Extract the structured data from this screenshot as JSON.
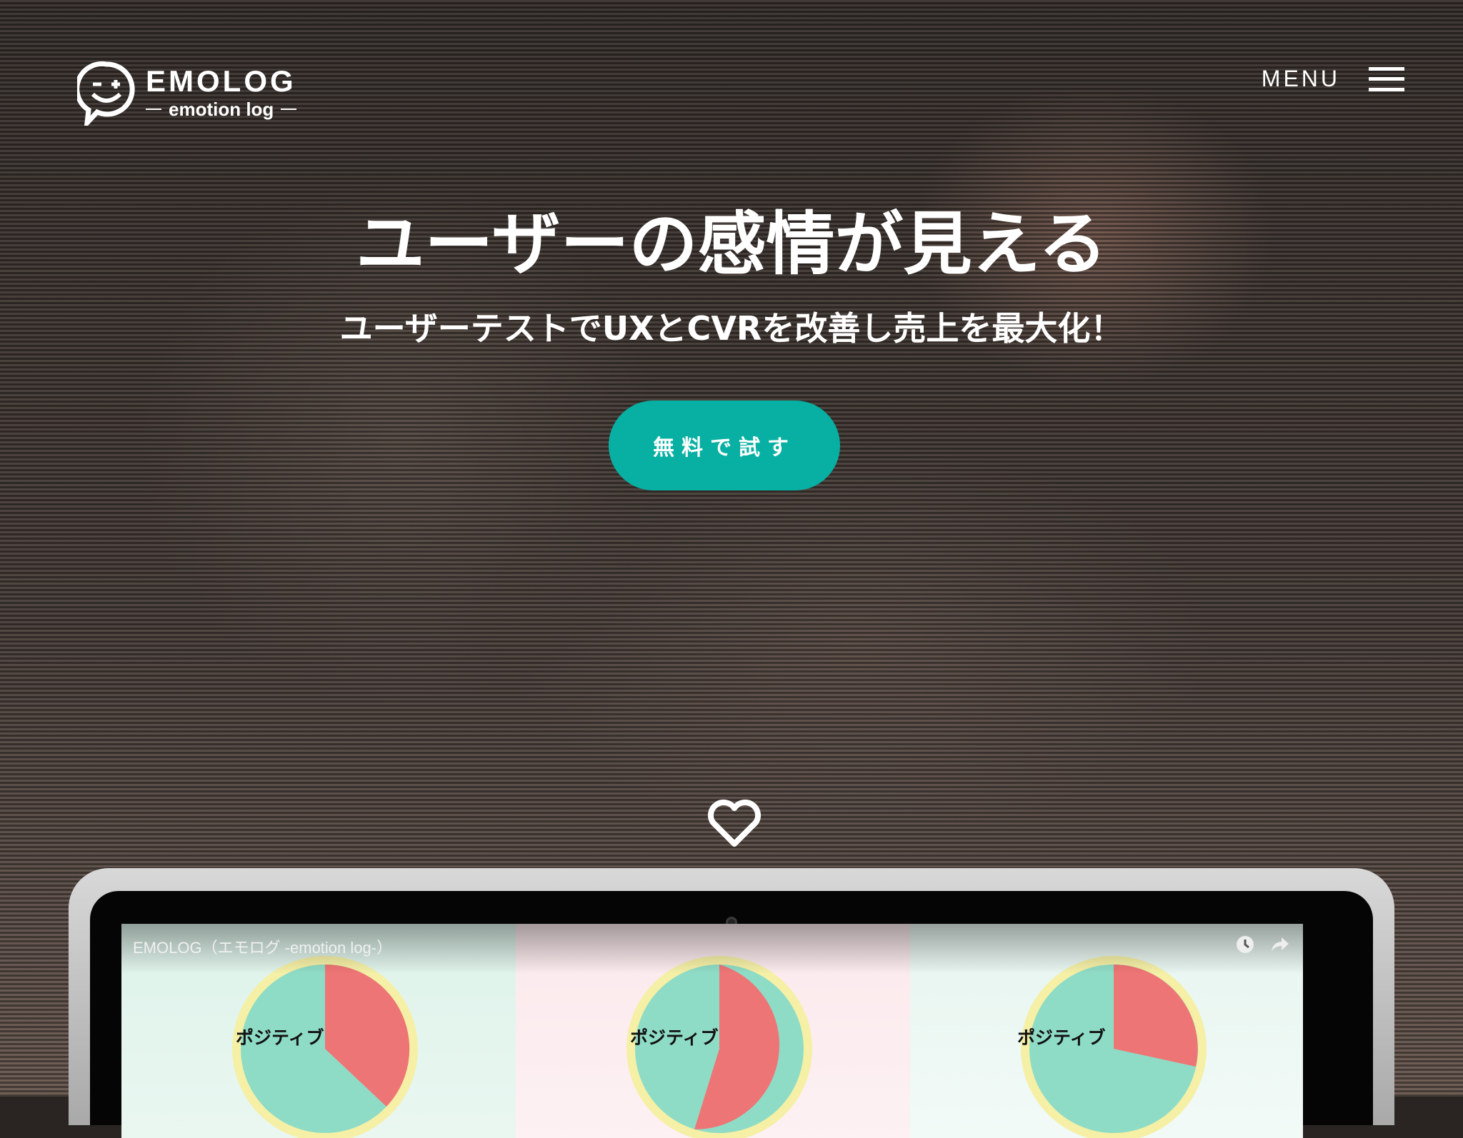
{
  "header": {
    "logo_name": "EMOLOG",
    "logo_sub": "emotion log",
    "menu_label": "MENU"
  },
  "hero": {
    "title": "ユーザーの感情が見える",
    "subtitle": "ユーザーテストでUXとCVRを改善し売上を最大化！",
    "cta_label": "無料で試す"
  },
  "video": {
    "title": "EMOLOG（エモログ -emotion log-）",
    "panels": [
      {
        "label": "ポジティブ"
      },
      {
        "label": "ポジティブ"
      },
      {
        "label": "ポジティブ"
      }
    ]
  },
  "colors": {
    "accent": "#07b0a2",
    "pie_negative": "#ee7575",
    "pie_positive": "#8fdcc6",
    "pie_ring": "#f5f0a6"
  },
  "icons": {
    "logo": "smiley-chat-icon",
    "menu": "hamburger-icon",
    "scroll": "heart-icon",
    "watch_later": "clock-icon",
    "share": "share-icon"
  }
}
